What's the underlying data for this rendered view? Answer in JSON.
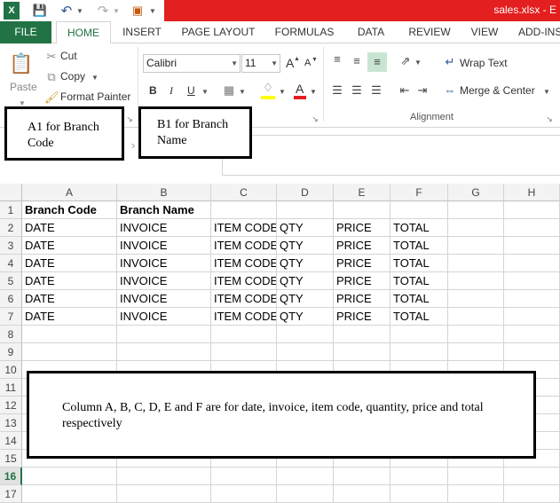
{
  "window": {
    "title": "sales.xlsx - E"
  },
  "tabs": [
    "FILE",
    "HOME",
    "INSERT",
    "PAGE LAYOUT",
    "FORMULAS",
    "DATA",
    "REVIEW",
    "VIEW",
    "ADD-INS"
  ],
  "clipboard": {
    "paste": "Paste",
    "cut": "Cut",
    "copy": "Copy",
    "format_painter": "Format Painter"
  },
  "font": {
    "name": "Calibri",
    "size": "11",
    "bold": "B",
    "italic": "I",
    "underline": "U",
    "grow": "A",
    "shrink": "A",
    "color_letter": "A"
  },
  "alignment": {
    "wrap_text": "Wrap Text",
    "merge_center": "Merge & Center",
    "group_label": "Alignment"
  },
  "annotations": {
    "a1": "A1 for Branch Code",
    "b1": "B1 for Branch Name",
    "columns": "Column A, B, C, D, E and F are for date, invoice, item code, quantity, price and total respectively"
  },
  "grid": {
    "columns": [
      "A",
      "B",
      "C",
      "D",
      "E",
      "F",
      "G",
      "H"
    ],
    "rows": [
      "1",
      "2",
      "3",
      "4",
      "5",
      "6",
      "7",
      "8",
      "9",
      "10",
      "11",
      "12",
      "13",
      "14",
      "15",
      "16",
      "17"
    ],
    "selected_row": "16",
    "row1": [
      "Branch Code",
      "Branch Name"
    ],
    "data_headers": [
      "DATE",
      "INVOICE",
      "ITEM CODE",
      "QTY",
      "PRICE",
      "TOTAL"
    ]
  },
  "colors": {
    "excel_green": "#217346",
    "title_red": "#e41f1f",
    "fill_yellow": "#ffff00",
    "font_red": "#e41f1f"
  }
}
